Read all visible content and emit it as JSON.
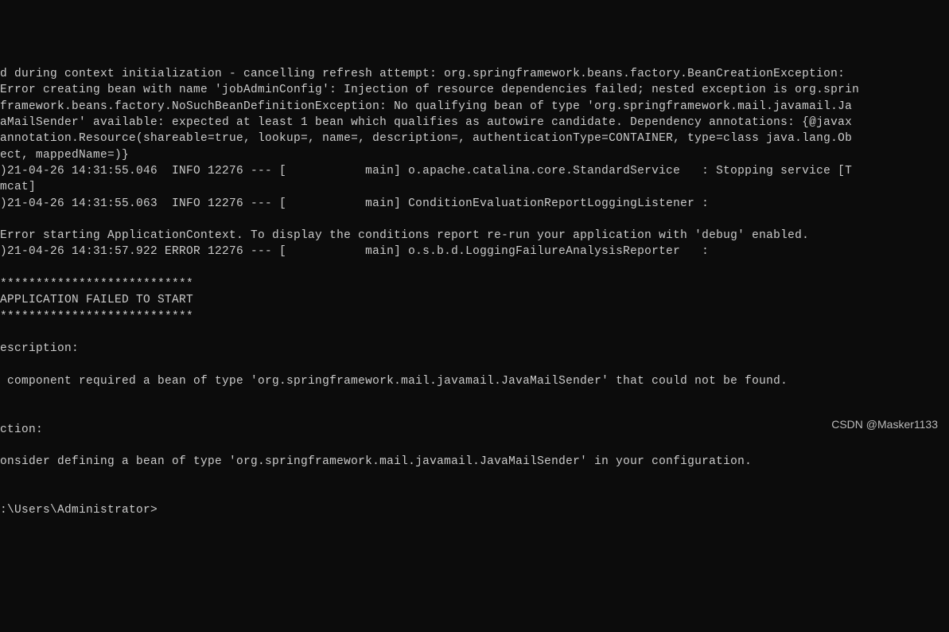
{
  "console": {
    "line1": "d during context initialization - cancelling refresh attempt: org.springframework.beans.factory.BeanCreationException:",
    "line2": "Error creating bean with name 'jobAdminConfig': Injection of resource dependencies failed; nested exception is org.sprin",
    "line3": "framework.beans.factory.NoSuchBeanDefinitionException: No qualifying bean of type 'org.springframework.mail.javamail.Ja",
    "line4": "aMailSender' available: expected at least 1 bean which qualifies as autowire candidate. Dependency annotations: {@javax",
    "line5": "annotation.Resource(shareable=true, lookup=, name=, description=, authenticationType=CONTAINER, type=class java.lang.Ob",
    "line6": "ect, mappedName=)}",
    "line7": ")21-04-26 14:31:55.046  INFO 12276 --- [           main] o.apache.catalina.core.StandardService   : Stopping service [T",
    "line8": "mcat]",
    "line9": ")21-04-26 14:31:55.063  INFO 12276 --- [           main] ConditionEvaluationReportLoggingListener :",
    "line10": "",
    "line11": "Error starting ApplicationContext. To display the conditions report re-run your application with 'debug' enabled.",
    "line12": ")21-04-26 14:31:57.922 ERROR 12276 --- [           main] o.s.b.d.LoggingFailureAnalysisReporter   :",
    "line13": "",
    "line14": "***************************",
    "line15": "APPLICATION FAILED TO START",
    "line16": "***************************",
    "line17": "",
    "line18": "escription:",
    "line19": "",
    "line20": " component required a bean of type 'org.springframework.mail.javamail.JavaMailSender' that could not be found.",
    "line21": "",
    "line22": "",
    "line23": "ction:",
    "line24": "",
    "line25": "onsider defining a bean of type 'org.springframework.mail.javamail.JavaMailSender' in your configuration.",
    "line26": "",
    "line27": "",
    "line28": ":\\Users\\Administrator>"
  },
  "watermark": "CSDN @Masker1133"
}
